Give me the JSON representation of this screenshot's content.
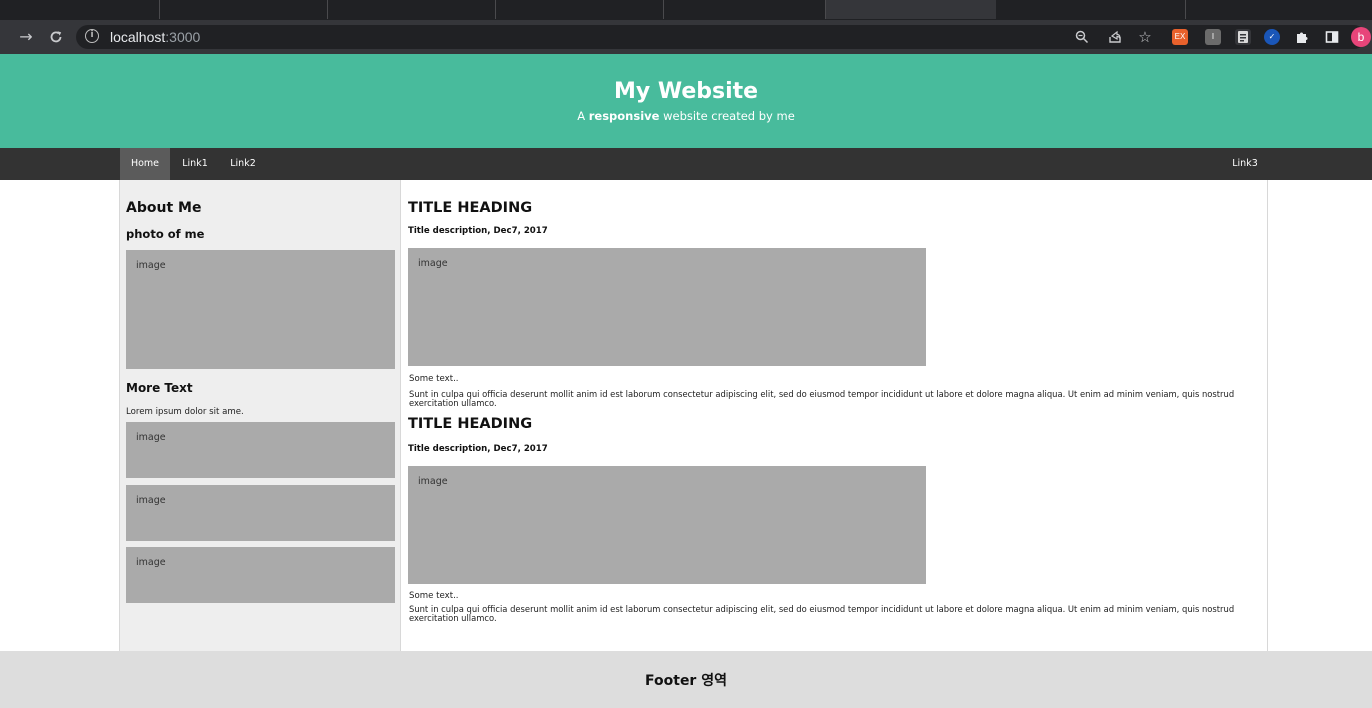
{
  "browser": {
    "url_host": "localhost",
    "url_port": ":3000",
    "extensions": [
      {
        "name": "ex-extension-icon",
        "label": "EX",
        "color": "#e8612c"
      },
      {
        "name": "gray-extension-icon",
        "label": "I",
        "color": "#6b6b6b"
      },
      {
        "name": "document-extension-icon",
        "label": "",
        "color": "#d9d9d9"
      },
      {
        "name": "check-extension-icon",
        "label": "✓",
        "color": "#1a56b8"
      }
    ],
    "profile_initial": "b"
  },
  "header": {
    "title": "My Website",
    "subtitle_prefix": "A ",
    "subtitle_bold": "responsive",
    "subtitle_suffix": " website created by me"
  },
  "nav": {
    "home": "Home",
    "link1": "Link1",
    "link2": "Link2",
    "link3": "Link3"
  },
  "sidebar": {
    "about_heading": "About Me",
    "photo_heading": "photo of me",
    "photo_label": "image",
    "more_heading": "More Text",
    "lorem": "Lorem ipsum dolor sit ame.",
    "images": [
      "image",
      "image",
      "image"
    ]
  },
  "posts": [
    {
      "title": "TITLE HEADING",
      "description": "Title description, Dec7, 2017",
      "image_label": "image",
      "some_text": "Some text..",
      "body": "Sunt in culpa qui officia deserunt mollit anim id est laborum consectetur adipiscing elit, sed do eiusmod tempor incididunt ut labore et dolore magna aliqua. Ut enim ad minim veniam, quis nostrud exercitation ullamco."
    },
    {
      "title": "TITLE HEADING",
      "description": "Title description, Dec7, 2017",
      "image_label": "image",
      "some_text": "Some text..",
      "body": "Sunt in culpa qui officia deserunt mollit anim id est laborum consectetur adipiscing elit, sed do eiusmod tempor incididunt ut labore et dolore magna aliqua. Ut enim ad minim veniam, quis nostrud exercitation ullamco."
    }
  ],
  "footer": {
    "text": "Footer 영역"
  }
}
